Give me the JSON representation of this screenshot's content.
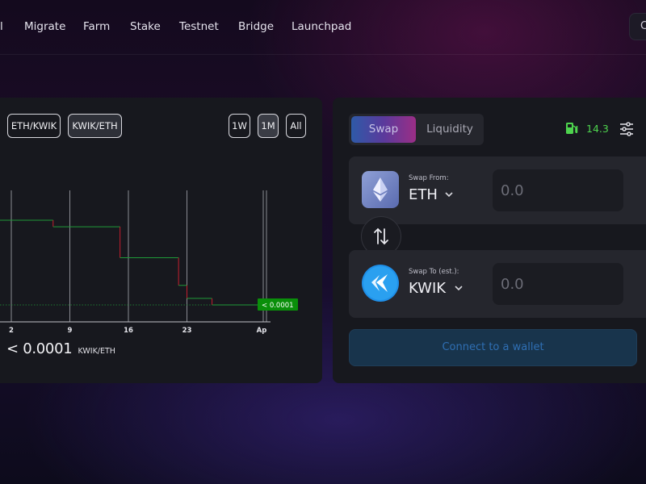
{
  "nav": {
    "edge_text": "l",
    "items": [
      "Migrate",
      "Farm",
      "Stake",
      "Testnet",
      "Bridge",
      "Launchpad"
    ],
    "right_button": "C"
  },
  "chart_panel": {
    "pairs": [
      "ETH/KWIK",
      "KWIK/ETH"
    ],
    "active_pair": "KWIK/ETH",
    "ranges": [
      "1W",
      "1M",
      "All"
    ],
    "active_range": "1M",
    "price_value": "< 0.0001",
    "price_unit": "KWIK/ETH"
  },
  "chart_data": {
    "type": "line",
    "x_tick_labels": [
      "2",
      "9",
      "16",
      "23",
      "Ap"
    ],
    "current_price_label": "< 0.0001",
    "series": [
      {
        "steps": [
          {
            "x": "2",
            "y": 5.2
          },
          {
            "x": "7",
            "y": 4.8
          },
          {
            "x": "15",
            "y": 2.9
          },
          {
            "x": "22",
            "y": 1.2
          },
          {
            "x": "23",
            "y": 0.4
          },
          {
            "x": "26",
            "y": 0.0
          }
        ]
      }
    ],
    "colors": {
      "up": "#1f9a38",
      "down": "#c41e2e",
      "grid": "#8a8b93"
    }
  },
  "swap_panel": {
    "tabs": [
      "Swap",
      "Liquidity"
    ],
    "active_tab": "Swap",
    "gas_value": "14.3",
    "from": {
      "caption": "Swap From:",
      "symbol": "ETH",
      "placeholder": "0.0"
    },
    "to": {
      "caption": "Swap To (est.):",
      "symbol": "KWIK",
      "placeholder": "0.0"
    },
    "connect_label": "Connect to a wallet"
  },
  "icons": {
    "gas": "gas-pump-icon",
    "settings": "sliders-icon",
    "switch": "swap-arrows-icon",
    "eth": "ethereum-logo-icon",
    "kwik": "kwik-logo-icon",
    "chevron": "chevron-down-icon"
  },
  "colors": {
    "gas": "#4ed34e",
    "accent_blue": "#2f6fb4",
    "marker_green": "#0a8f0a"
  }
}
